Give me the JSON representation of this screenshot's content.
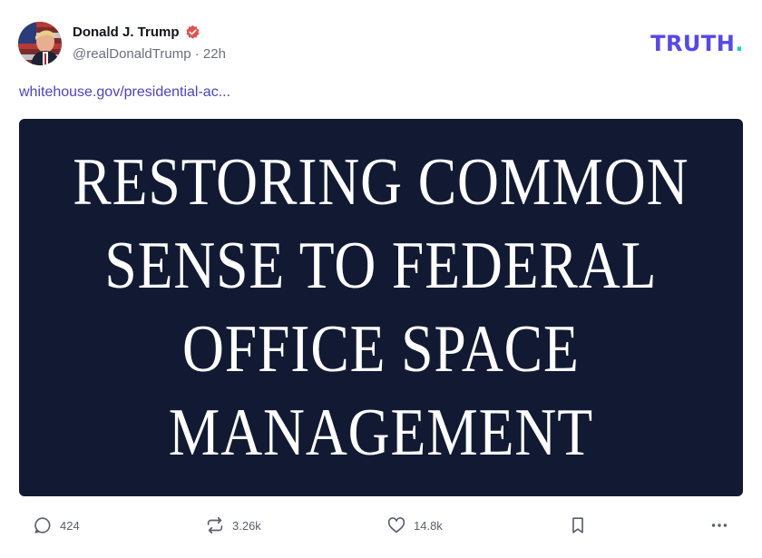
{
  "post": {
    "author": {
      "display_name": "Donald J. Trump",
      "handle": "@realDonaldTrump",
      "time_ago": "22h",
      "verified": true,
      "avatar_icon": "avatar-portrait"
    },
    "brand": {
      "name": "TRUTH",
      "dot": ".",
      "color": "#5448ee",
      "dot_color": "#17d1c6"
    },
    "link_text": "whitehouse.gov/presidential-ac...",
    "media": {
      "lines": [
        "RESTORING COMMON",
        "SENSE TO FEDERAL",
        "OFFICE SPACE",
        "MANAGEMENT"
      ],
      "background": "#121a33"
    },
    "actions": {
      "reply_count": "424",
      "retruth_count": "3.26k",
      "like_count": "14.8k",
      "icons": [
        "reply-icon",
        "retruth-icon",
        "like-icon",
        "bookmark-icon",
        "more-icon"
      ]
    }
  }
}
